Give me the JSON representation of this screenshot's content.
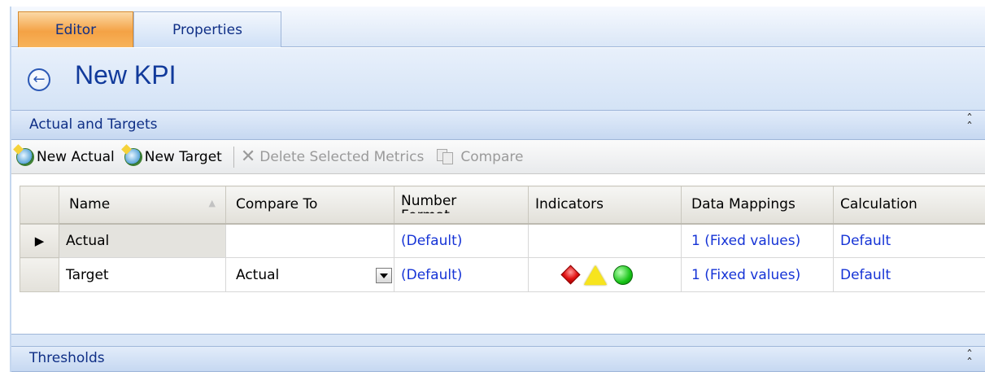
{
  "tabs": [
    {
      "label": "Editor",
      "active": true
    },
    {
      "label": "Properties",
      "active": false
    }
  ],
  "page": {
    "title": "New KPI"
  },
  "sections": {
    "actual_targets": {
      "label": "Actual and Targets"
    },
    "thresholds": {
      "label": "Thresholds"
    }
  },
  "toolbar": {
    "new_actual": "New Actual",
    "new_target": "New Target",
    "delete_selected": "Delete Selected Metrics",
    "compare": "Compare"
  },
  "grid": {
    "columns": [
      "Name",
      "Compare To",
      "Number Format",
      "Indicators",
      "Data Mappings",
      "Calculation"
    ],
    "number_format_visible": "Number",
    "rows": [
      {
        "name": "Actual",
        "compare_to": "",
        "number_format": "(Default)",
        "indicators": [],
        "data_mappings": "1 (Fixed values)",
        "calculation": "Default",
        "current": true
      },
      {
        "name": "Target",
        "compare_to": "Actual",
        "number_format": "(Default)",
        "indicators": [
          "red-diamond",
          "yellow-triangle",
          "green-circle"
        ],
        "data_mappings": "1 (Fixed values)",
        "calculation": "Default",
        "current": false
      }
    ]
  },
  "colors": {
    "link": "#1533d6",
    "title": "#113a9b",
    "active_tab": "#f4a245",
    "header_band": "#c6d8f1"
  }
}
